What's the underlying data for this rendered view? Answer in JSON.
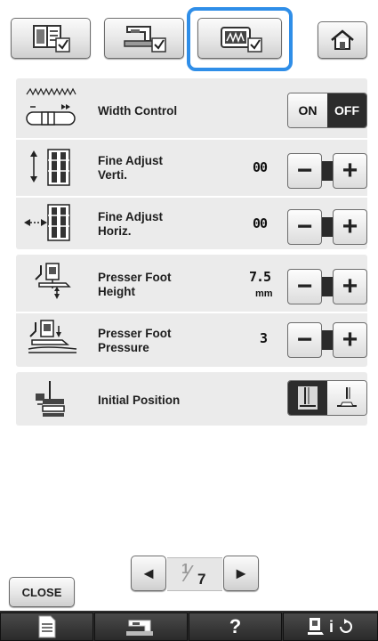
{
  "tabs": [
    {
      "name": "general-settings-tab",
      "icon": "book-check-icon"
    },
    {
      "name": "machine-settings-tab",
      "icon": "machine-check-icon"
    },
    {
      "name": "sewing-settings-tab",
      "icon": "stitch-check-icon",
      "active": true
    }
  ],
  "home_icon": "home-icon",
  "rows": {
    "width_control": {
      "label": "Width Control",
      "on": "ON",
      "off": "OFF"
    },
    "fine_adjust_verti": {
      "label_1": "Fine Adjust",
      "label_2": "Verti.",
      "value": "00"
    },
    "fine_adjust_horiz": {
      "label_1": "Fine Adjust",
      "label_2": "Horiz.",
      "value": "00"
    },
    "presser_foot_height": {
      "label_1": "Presser Foot",
      "label_2": "Height",
      "value": "7.5",
      "unit": "mm"
    },
    "presser_foot_pressure": {
      "label_1": "Presser Foot",
      "label_2": "Pressure",
      "value": "3"
    },
    "initial_position": {
      "label": "Initial Position"
    }
  },
  "stepper": {
    "minus": "−",
    "plus": "+"
  },
  "pagination": {
    "prev": "◄",
    "current": "1",
    "total": "7",
    "next": "►"
  },
  "close_label": "CLOSE",
  "bottom_bar": {
    "help": "?",
    "info": "i"
  },
  "colors": {
    "highlight": "#2f8ee8",
    "panel": "#ebebeb",
    "bar": "#2c2c2c"
  }
}
